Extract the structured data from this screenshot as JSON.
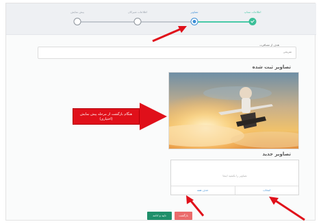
{
  "stepper": {
    "steps": [
      {
        "label": "پیش نمایش",
        "state": "pending"
      },
      {
        "label": "اطلاعات شیرکان",
        "state": "pending"
      },
      {
        "label": "تصاویر",
        "state": "active"
      },
      {
        "label": "اطلاعات ستاپ",
        "state": "done"
      }
    ]
  },
  "form": {
    "field_label": "هدف از مسافرت",
    "field_value": "تفریحی"
  },
  "registered_images": {
    "title": "تصاویر ثبت شده"
  },
  "annotation": {
    "callout_text": "هنگام بازگشت از مرحله پیش نمایش (اختیاری)"
  },
  "new_images": {
    "title": "تصاویر جدید",
    "upload_hint": "تصاویر را بکشید اینجا",
    "choose_label": "انتخاب",
    "remove_label": "حذف همه"
  },
  "actions": {
    "confirm_label": "تایید و ادامه",
    "back_label": "بازگشت"
  },
  "colors": {
    "accent": "#3d8fd6",
    "done": "#3bbf98",
    "confirm": "#1f8f6a",
    "back": "#ea6b6b",
    "annotation": "#e0101a"
  }
}
